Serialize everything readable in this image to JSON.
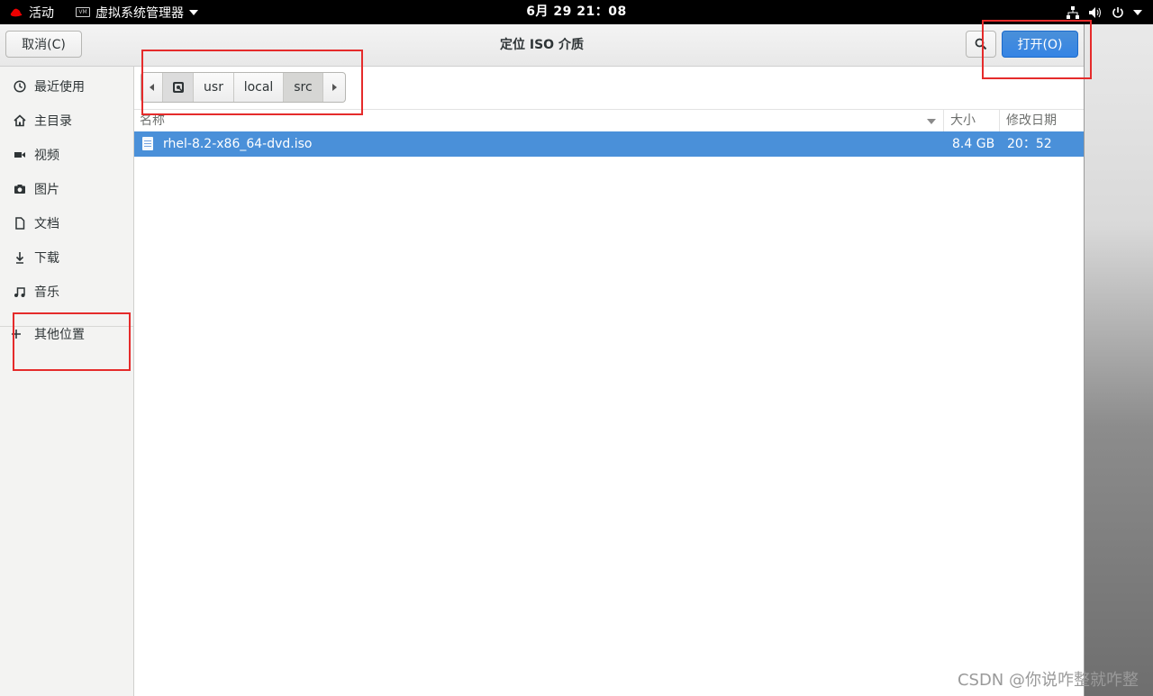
{
  "topbar": {
    "activities": "活动",
    "app_menu": "虚拟系统管理器",
    "clock": "6月 29 21：08"
  },
  "dialog": {
    "title": "定位 ISO 介质",
    "cancel_label": "取消(C)",
    "open_label": "打开(O)"
  },
  "sidebar": {
    "items": [
      {
        "label": "最近使用",
        "icon": "clock-icon"
      },
      {
        "label": "主目录",
        "icon": "home-icon"
      },
      {
        "label": "视频",
        "icon": "video-icon"
      },
      {
        "label": "图片",
        "icon": "camera-icon"
      },
      {
        "label": "文档",
        "icon": "document-icon"
      },
      {
        "label": "下载",
        "icon": "download-icon"
      },
      {
        "label": "音乐",
        "icon": "music-icon"
      },
      {
        "label": "其他位置",
        "icon": "plus-icon"
      }
    ]
  },
  "pathbar": {
    "crumbs": [
      "usr",
      "local",
      "src"
    ]
  },
  "file_list": {
    "columns": [
      "名称",
      "大小",
      "修改日期"
    ],
    "rows": [
      {
        "name": "rhel-8.2-x86_64-dvd.iso",
        "size": "8.4 GB",
        "modified": "20：52"
      }
    ]
  },
  "colors": {
    "accent": "#4a90d9",
    "annotation": "#e52b2b"
  },
  "watermark": "CSDN @你说咋整就咋整"
}
